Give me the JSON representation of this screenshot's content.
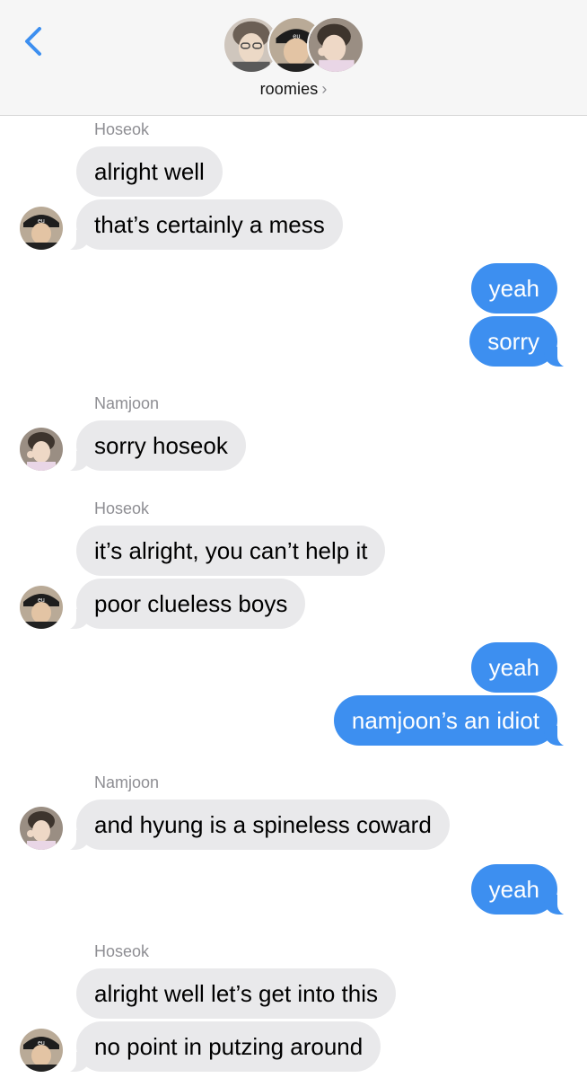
{
  "header": {
    "group_name": "roomies",
    "chevron": "›",
    "back_icon": "chevron-left-icon",
    "accent_color": "#3d8ff0"
  },
  "messages": [
    {
      "type": "sender",
      "text": "Hoseok"
    },
    {
      "type": "in",
      "text": "alright well"
    },
    {
      "type": "in",
      "text": "that’s certainly a mess",
      "avatar": "hoseok"
    },
    {
      "type": "out",
      "text": "yeah"
    },
    {
      "type": "out",
      "text": "sorry"
    },
    {
      "type": "sender",
      "text": "Namjoon"
    },
    {
      "type": "in",
      "text": "sorry hoseok",
      "avatar": "namjoon"
    },
    {
      "type": "sender",
      "text": "Hoseok"
    },
    {
      "type": "in",
      "text": "it’s alright, you can’t help it"
    },
    {
      "type": "in",
      "text": "poor clueless boys",
      "avatar": "hoseok"
    },
    {
      "type": "out",
      "text": "yeah"
    },
    {
      "type": "out",
      "text": "namjoon’s an idiot"
    },
    {
      "type": "sender",
      "text": "Namjoon"
    },
    {
      "type": "in",
      "text": "and hyung is a spineless coward",
      "avatar": "namjoon"
    },
    {
      "type": "out",
      "text": "yeah"
    },
    {
      "type": "sender",
      "text": "Hoseok"
    },
    {
      "type": "in",
      "text": "alright well let’s get into this"
    },
    {
      "type": "in",
      "text": "no point in putzing around",
      "avatar": "hoseok"
    }
  ]
}
